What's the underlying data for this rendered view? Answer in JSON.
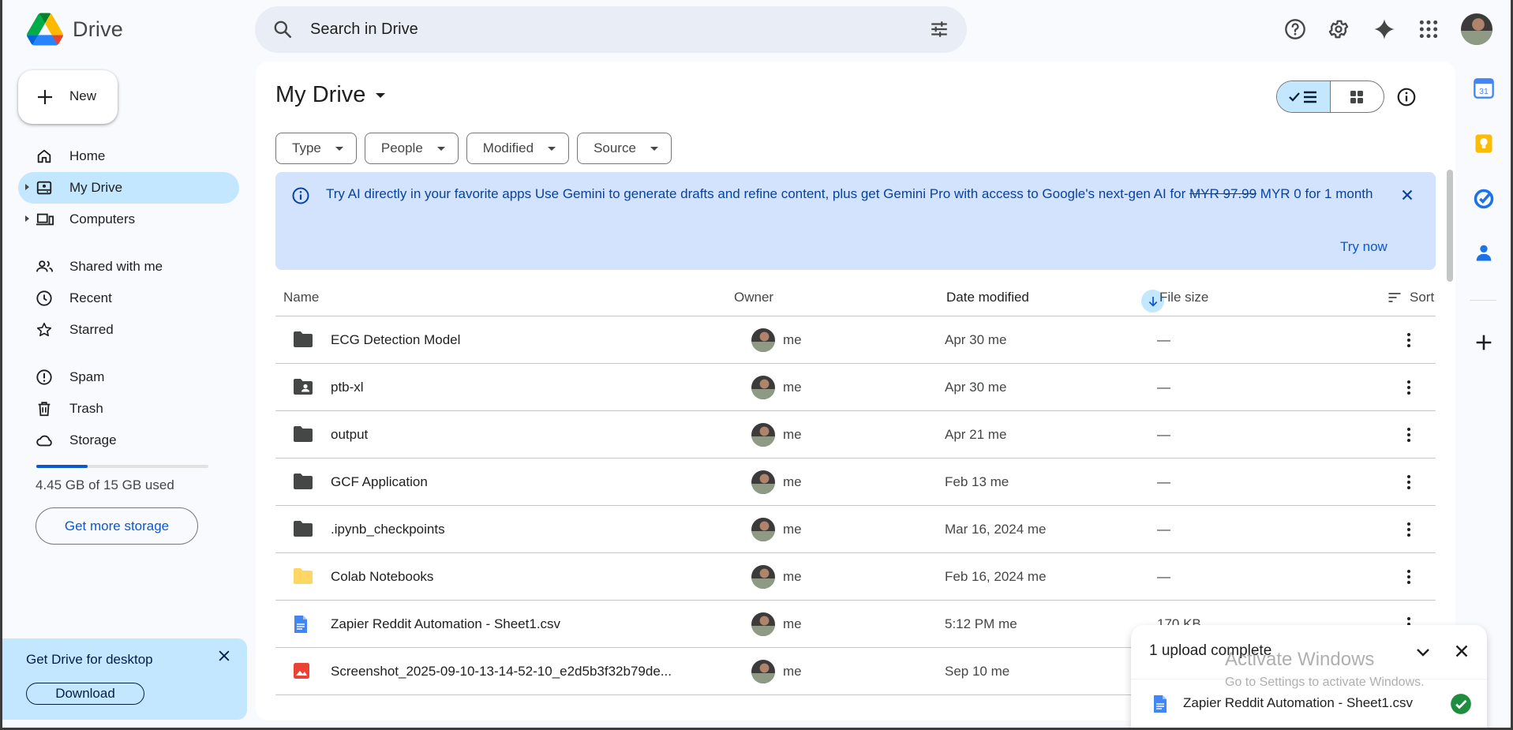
{
  "app": {
    "name": "Drive"
  },
  "search": {
    "placeholder": "Search in Drive"
  },
  "sidebar": {
    "new_label": "New",
    "items": [
      {
        "label": "Home"
      },
      {
        "label": "My Drive"
      },
      {
        "label": "Computers"
      },
      {
        "label": "Shared with me"
      },
      {
        "label": "Recent"
      },
      {
        "label": "Starred"
      },
      {
        "label": "Spam"
      },
      {
        "label": "Trash"
      },
      {
        "label": "Storage"
      }
    ],
    "storage": {
      "used_text": "4.45 GB of 15 GB used",
      "used_fraction": 0.297,
      "button_label": "Get more storage"
    },
    "desktop_promo": {
      "title": "Get Drive for desktop",
      "button_label": "Download"
    }
  },
  "main": {
    "title": "My Drive",
    "filters": [
      "Type",
      "People",
      "Modified",
      "Source"
    ],
    "banner": {
      "headline": "Try AI directly in your favorite apps",
      "body_before": "Use Gemini to generate drafts and refine content, plus get Gemini Pro with access to Google's next-gen AI for",
      "old_price": "MYR 97.99",
      "body_after": "MYR 0 for 1 month",
      "action": "Try now"
    },
    "columns": {
      "name": "Name",
      "owner": "Owner",
      "date": "Date modified",
      "size": "File size",
      "sort": "Sort"
    },
    "rows": [
      {
        "name": "ECG Detection Model",
        "type": "folder",
        "owner": "me",
        "date": "Apr 30 me",
        "size": "—"
      },
      {
        "name": "ptb-xl",
        "type": "shared-folder",
        "owner": "me",
        "date": "Apr 30 me",
        "size": "—"
      },
      {
        "name": "output",
        "type": "folder",
        "owner": "me",
        "date": "Apr 21 me",
        "size": "—"
      },
      {
        "name": "GCF Application",
        "type": "folder",
        "owner": "me",
        "date": "Feb 13 me",
        "size": "—"
      },
      {
        "name": ".ipynb_checkpoints",
        "type": "folder",
        "owner": "me",
        "date": "Mar 16, 2024 me",
        "size": "—"
      },
      {
        "name": "Colab Notebooks",
        "type": "folder-yellow",
        "owner": "me",
        "date": "Feb 16, 2024 me",
        "size": "—"
      },
      {
        "name": "Zapier Reddit Automation - Sheet1.csv",
        "type": "doc",
        "owner": "me",
        "date": "5:12 PM me",
        "size": "170 KB"
      },
      {
        "name": "Screenshot_2025-09-10-13-14-52-10_e2d5b3f32b79de...",
        "type": "image",
        "owner": "me",
        "date": "Sep 10 me",
        "size": ""
      }
    ]
  },
  "upload": {
    "header": "1 upload complete",
    "file": "Zapier Reddit Automation - Sheet1.csv"
  },
  "watermark": {
    "line1": "Activate Windows",
    "line2": "Go to Settings to activate Windows."
  },
  "colors": {
    "accent": "#0b57d0",
    "selected": "#c2e7ff",
    "banner": "#d3e3fd"
  }
}
